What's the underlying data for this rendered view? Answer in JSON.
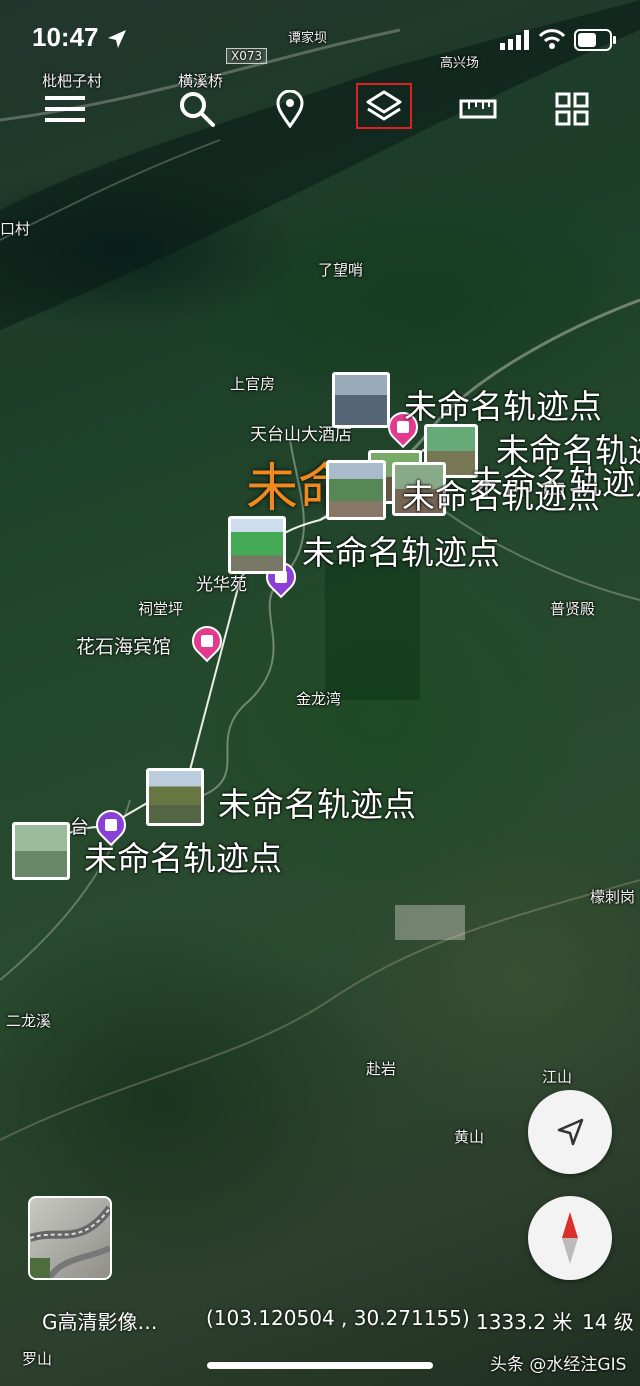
{
  "status_bar": {
    "time": "10:47"
  },
  "toolbar": {
    "items": [
      "menu-icon",
      "search-icon",
      "location-pin-icon",
      "layers-icon",
      "ruler-icon",
      "grid-icon"
    ],
    "highlight_color": "#e02020"
  },
  "map_labels": {
    "x073": "X073",
    "tanjiaba": "谭家坝",
    "gaoxingchang": "高兴场",
    "pibazichang": "枇杷子村",
    "hengxiqiao": "横溪桥",
    "kouchun": "口村",
    "liaowangshao": "了望哨",
    "shangguanfang": "上官房",
    "tiantaishan": "天台山大酒店",
    "guanghuayuan": "光华苑",
    "citangping": "祠堂坪",
    "huashihai": "花石海宾馆",
    "jinlongwan": "金龙湾",
    "puxiandian": "普贤殿",
    "erlongxi": "二龙溪",
    "tanyan": "赴岩",
    "jiangshan": "江山",
    "huangshan": "黄山",
    "zhaciwan": "檬刺岗",
    "luoshan": "罗山",
    "tai": "台"
  },
  "selected_label": "未命",
  "track_points": [
    "未命名轨迹点",
    "未命名轨迹点",
    "未命名轨迹点",
    "未命名轨迹点",
    "未命名轨迹点",
    "未命名轨迹点",
    "未命名轨迹点"
  ],
  "footer": {
    "layer_name": "G高清影像…",
    "coordinates": "(103.120504 , 30.271155)",
    "altitude": "1333.2 米",
    "zoom": "14 级"
  },
  "watermark": "头条 @水经注GIS",
  "colors": {
    "pin_pink": "#e23a8f",
    "pin_purple": "#8a3fd6",
    "selected_orange": "#f08a1e",
    "compass_red": "#d9302c"
  }
}
